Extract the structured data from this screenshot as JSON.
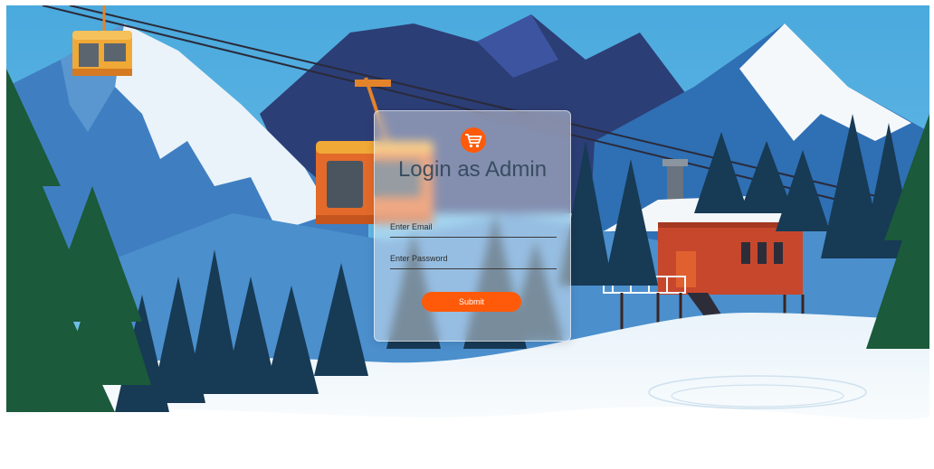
{
  "login": {
    "title": "Login as Admin",
    "email_placeholder": "Enter Email",
    "password_placeholder": "Enter Password",
    "submit_label": "Submit",
    "accent_color": "#ff5a0a"
  },
  "icons": {
    "logo": "shopping-cart-icon"
  }
}
